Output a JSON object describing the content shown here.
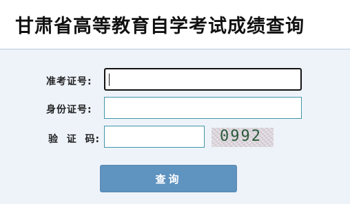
{
  "header": {
    "title": "甘肃省高等教育自学考试成绩查询"
  },
  "form": {
    "exam_id_label": "准考证号:",
    "exam_id_value": "",
    "id_card_label": "身份证号:",
    "id_card_value": "",
    "captcha_label": "验  证  码:",
    "captcha_value": "",
    "captcha_image_text": "0992",
    "submit_label": "查询"
  }
}
